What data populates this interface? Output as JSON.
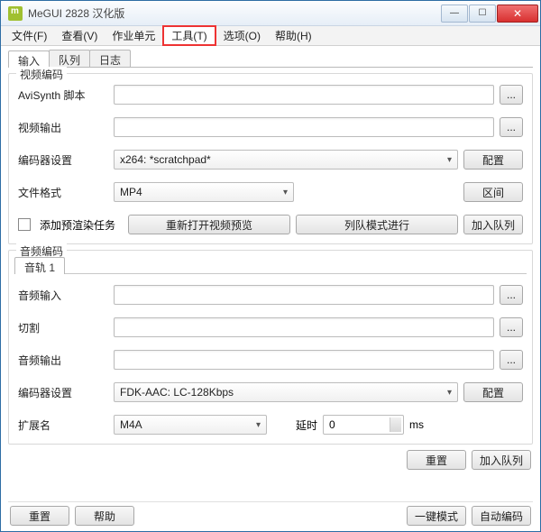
{
  "window": {
    "title": "MeGUI 2828 汉化版"
  },
  "titlebar_btns": {
    "min": "—",
    "max": "☐",
    "close": "✕"
  },
  "menu": {
    "file": "文件(F)",
    "view": "查看(V)",
    "workunit": "作业单元",
    "tools": "工具(T)",
    "options": "选项(O)",
    "help": "帮助(H)"
  },
  "tabs": {
    "input": "输入",
    "queue": "队列",
    "log": "日志"
  },
  "video": {
    "group_title": "视频编码",
    "avisynth_label": "AviSynth 脚本",
    "output_label": "视频输出",
    "encoder_label": "编码器设置",
    "encoder_value": "x264: *scratchpad*",
    "config_btn": "配置",
    "format_label": "文件格式",
    "format_value": "MP4",
    "range_btn": "区间",
    "prerender_label": "添加预渲染任务",
    "reopen_btn": "重新打开视频预览",
    "queue_mode_btn": "列队模式进行",
    "enqueue_btn": "加入队列",
    "browse": "..."
  },
  "audio": {
    "group_title": "音频编码",
    "track_tab": "音轨 1",
    "input_label": "音频输入",
    "cut_label": "切割",
    "output_label": "音频输出",
    "encoder_label": "编码器设置",
    "encoder_value": "FDK-AAC: LC-128Kbps",
    "config_btn": "配置",
    "ext_label": "扩展名",
    "ext_value": "M4A",
    "delay_label": "延时",
    "delay_value": "0",
    "delay_unit": "ms",
    "reset_btn": "重置",
    "enqueue_btn": "加入队列",
    "browse": "..."
  },
  "footer": {
    "reset": "重置",
    "help": "帮助",
    "oneclick": "一键模式",
    "autoencode": "自动编码"
  }
}
